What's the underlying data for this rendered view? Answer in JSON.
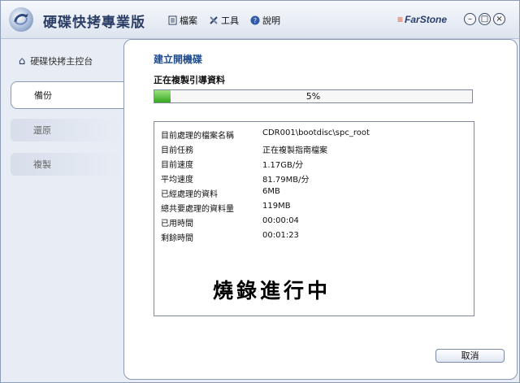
{
  "app": {
    "title": "硬碟快拷專業版",
    "brand": "FarStone"
  },
  "menu": [
    {
      "label": "檔案",
      "icon": "file-icon"
    },
    {
      "label": "工具",
      "icon": "tools-icon"
    },
    {
      "label": "說明",
      "icon": "help-icon"
    }
  ],
  "window_buttons": [
    "minimize",
    "maximize",
    "close"
  ],
  "sidebar": {
    "home": "硬碟快拷主控台",
    "items": [
      "備份",
      "還原",
      "複製"
    ]
  },
  "main": {
    "title": "建立開機碟",
    "status": "正在複製引導資料",
    "progress": {
      "percent": 5,
      "label": "5%"
    },
    "details": [
      {
        "label": "目前處理的檔案名稱",
        "value": "CDR001\\bootdisc\\spc_root"
      },
      {
        "label": "目前任務",
        "value": "正在複製指南檔案"
      },
      {
        "label": "目前速度",
        "value": "1.17GB/分"
      },
      {
        "label": "平均速度",
        "value": "81.79MB/分"
      },
      {
        "label": "已經處理的資料",
        "value": "6MB"
      },
      {
        "label": "總共要處理的資料量",
        "value": "119MB"
      },
      {
        "label": "已用時間",
        "value": "00:00:04"
      },
      {
        "label": "剩餘時間",
        "value": "00:01:23"
      }
    ],
    "overlay_text": "燒錄進行中",
    "cancel_label": "取消"
  },
  "colors": {
    "accent": "#1f4a8a",
    "progress": "#34a81e",
    "brand_swoosh": "#e0461f"
  }
}
